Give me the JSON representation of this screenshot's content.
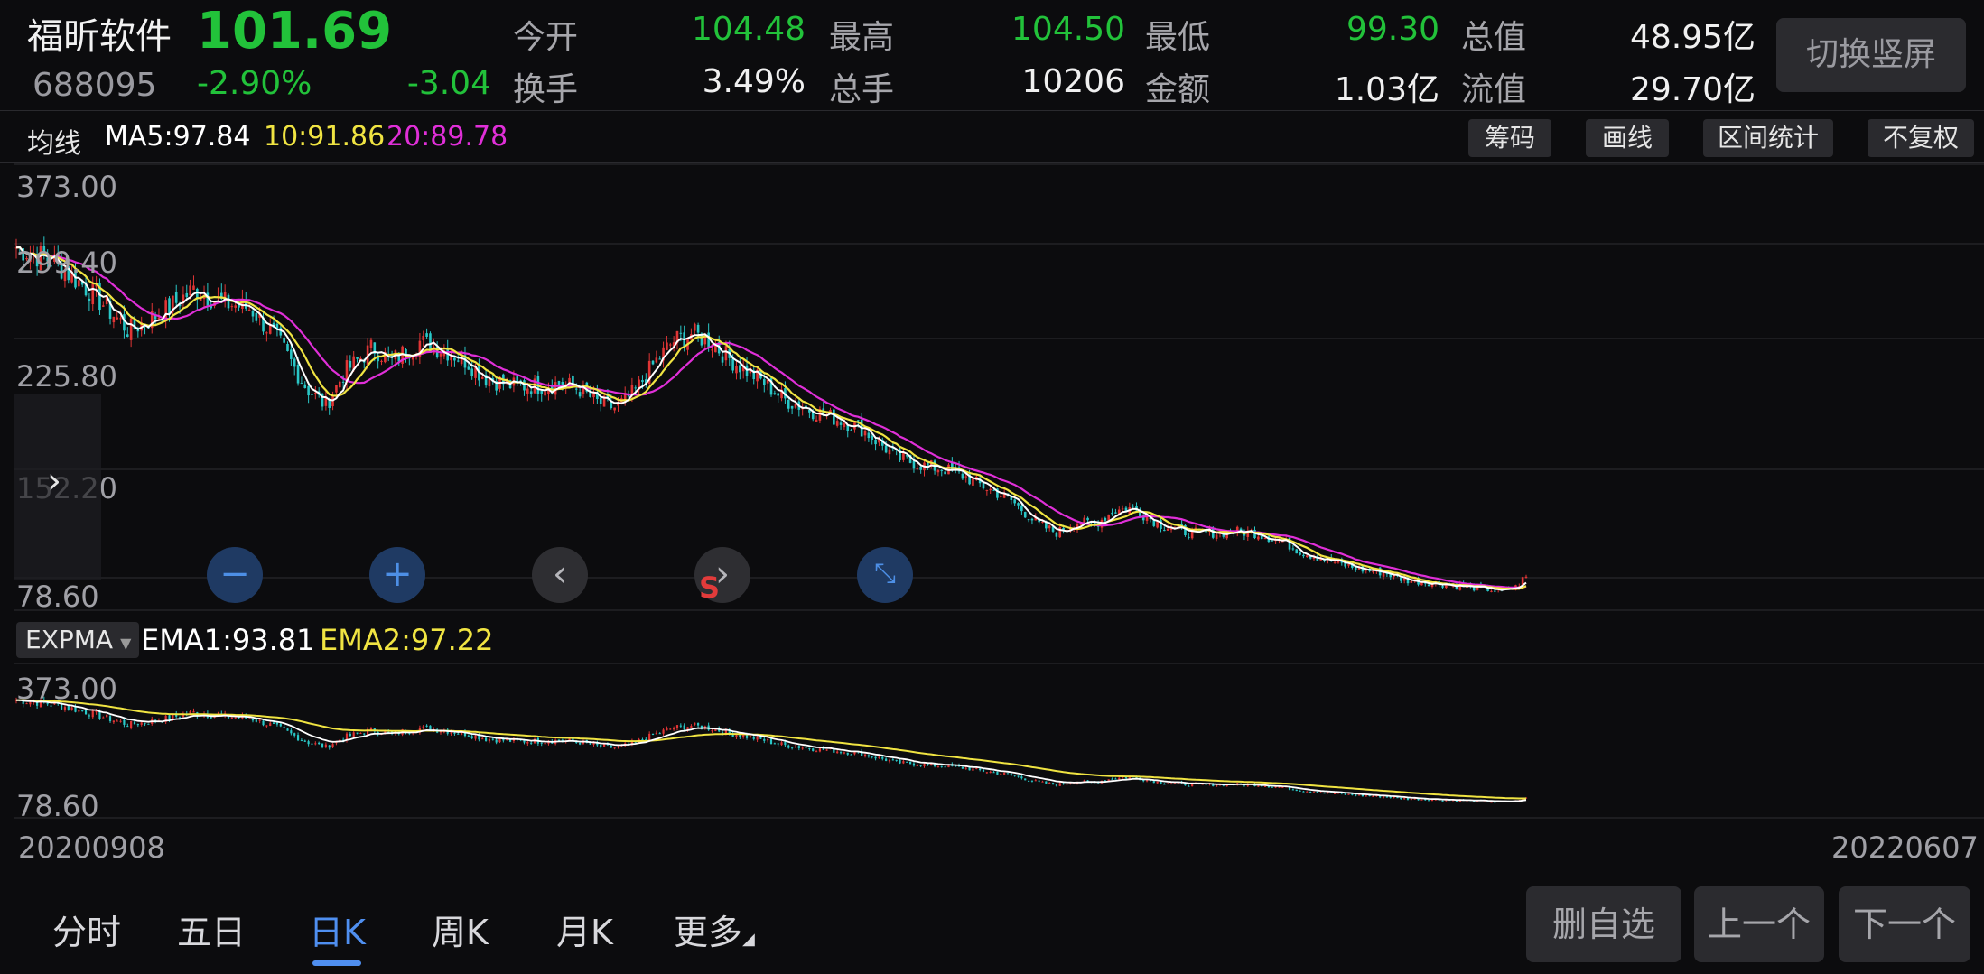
{
  "stock": {
    "name": "福昕软件",
    "price": "101.69",
    "code": "688095",
    "change_pct": "-2.90%",
    "change": "-3.04"
  },
  "quotes": [
    {
      "label": "今开",
      "value": "104.48",
      "color": "#22c23a"
    },
    {
      "label": "最高",
      "value": "104.50",
      "color": "#22c23a"
    },
    {
      "label": "最低",
      "value": "99.30",
      "color": "#22c23a"
    },
    {
      "label": "总值",
      "value": "48.95亿",
      "color": "#f0f0f0"
    },
    {
      "label": "换手",
      "value": "3.49%",
      "color": "#f0f0f0"
    },
    {
      "label": "总手",
      "value": "10206",
      "color": "#f0f0f0"
    },
    {
      "label": "金额",
      "value": "1.03亿",
      "color": "#f0f0f0"
    },
    {
      "label": "流值",
      "value": "29.70亿",
      "color": "#f0f0f0"
    }
  ],
  "switch_button": "切换竖屏",
  "ma": {
    "label": "均线",
    "ma5": "MA5:97.84",
    "ma10": "10:91.86",
    "ma20": "20:89.78",
    "colors": {
      "ma5": "#ffffff",
      "ma10": "#f0e442",
      "ma20": "#e02fd8"
    }
  },
  "tool_buttons": [
    "筹码",
    "画线",
    "区间统计",
    "不复权"
  ],
  "main_axis": [
    "373.00",
    "299.40",
    "225.80",
    "152.20",
    "78.60"
  ],
  "sub_axis": [
    "373.00",
    "78.60"
  ],
  "expma": {
    "tag": "EXPMA",
    "ema1": "EMA1:93.81",
    "ema2": "EMA2:97.22"
  },
  "dates": {
    "start": "20200908",
    "end": "20220607"
  },
  "tabs": [
    "分时",
    "五日",
    "日K",
    "周K",
    "月K",
    "更多"
  ],
  "active_tab": "日K",
  "bottom_buttons": [
    "删自选",
    "上一个",
    "下一个"
  ],
  "chart_data": {
    "type": "line",
    "ylim": [
      78.6,
      373.0
    ],
    "anchors": [
      [
        0,
        330
      ],
      [
        40,
        320
      ],
      [
        80,
        298
      ],
      [
        120,
        270
      ],
      [
        160,
        285
      ],
      [
        190,
        300
      ],
      [
        220,
        290
      ],
      [
        250,
        286
      ],
      [
        280,
        262
      ],
      [
        310,
        228
      ],
      [
        330,
        216
      ],
      [
        350,
        240
      ],
      [
        380,
        258
      ],
      [
        400,
        248
      ],
      [
        430,
        262
      ],
      [
        460,
        255
      ],
      [
        480,
        248
      ],
      [
        500,
        236
      ],
      [
        530,
        230
      ],
      [
        560,
        230
      ],
      [
        580,
        232
      ],
      [
        600,
        228
      ],
      [
        620,
        218
      ],
      [
        640,
        214
      ],
      [
        660,
        226
      ],
      [
        680,
        246
      ],
      [
        700,
        262
      ],
      [
        720,
        268
      ],
      [
        740,
        262
      ],
      [
        760,
        250
      ],
      [
        790,
        236
      ],
      [
        820,
        220
      ],
      [
        850,
        212
      ],
      [
        880,
        205
      ],
      [
        900,
        200
      ],
      [
        940,
        178
      ],
      [
        970,
        172
      ],
      [
        990,
        170
      ],
      [
        1010,
        165
      ],
      [
        1030,
        158
      ],
      [
        1060,
        148
      ],
      [
        1090,
        130
      ],
      [
        1110,
        124
      ],
      [
        1130,
        132
      ],
      [
        1150,
        130
      ],
      [
        1170,
        140
      ],
      [
        1190,
        142
      ],
      [
        1220,
        130
      ],
      [
        1250,
        124
      ],
      [
        1280,
        124
      ],
      [
        1300,
        125
      ],
      [
        1320,
        124
      ],
      [
        1350,
        118
      ],
      [
        1370,
        110
      ],
      [
        1400,
        104
      ],
      [
        1430,
        98
      ],
      [
        1460,
        95
      ],
      [
        1480,
        90
      ],
      [
        1510,
        88
      ],
      [
        1560,
        84
      ],
      [
        1585,
        82
      ],
      [
        1600,
        85
      ],
      [
        1608,
        92
      ]
    ]
  }
}
